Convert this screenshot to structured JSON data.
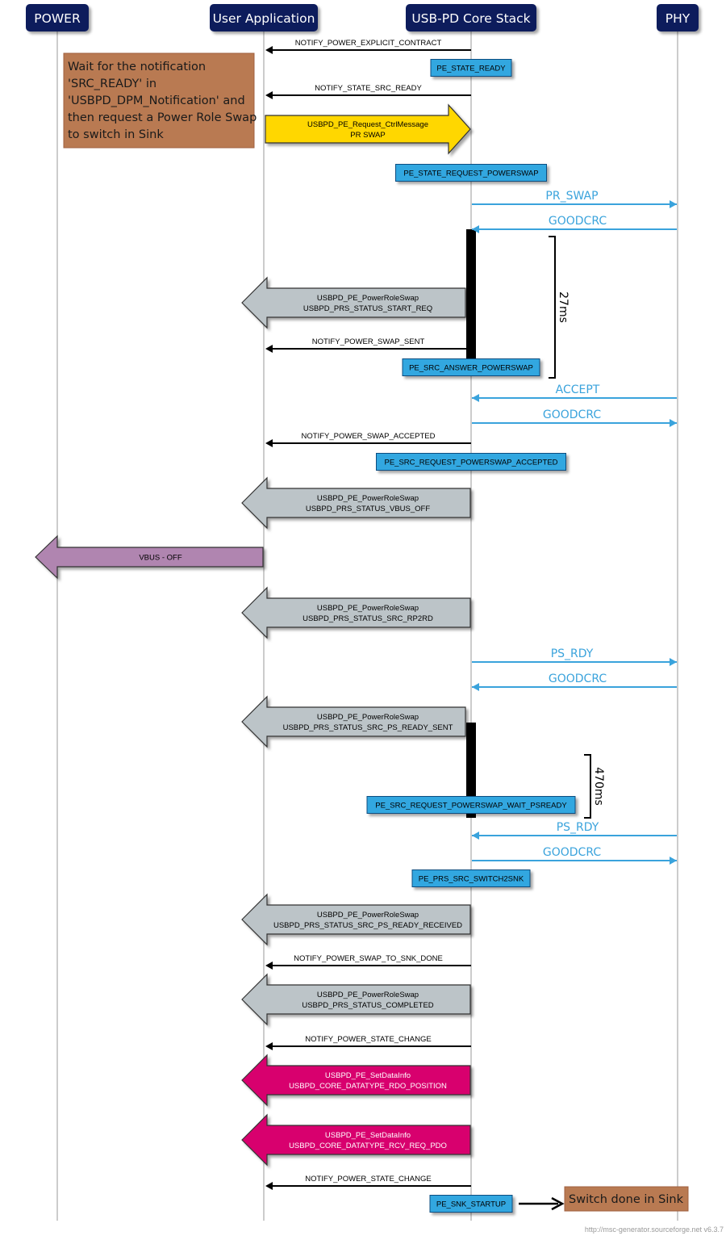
{
  "entities": [
    {
      "id": "power",
      "label": "POWER"
    },
    {
      "id": "app",
      "label": "User Application"
    },
    {
      "id": "core",
      "label": "USB-PD Core Stack"
    },
    {
      "id": "phy",
      "label": "PHY"
    }
  ],
  "colors": {
    "header_bg": "#0a1a5c",
    "lifeline": "#b0b0b0",
    "state_box": "#30a7e0",
    "phy_message": "#3aa3dc",
    "note_bg": "#b97a52",
    "request_arrow": "#ffd700",
    "status_arrow": "#bcc4c8",
    "vbus_arrow": "#b085b0",
    "datainfo_arrow": "#d8006e"
  },
  "note_top": {
    "lines": [
      "Wait for the notification",
      "'SRC_READY' in",
      "'USBPD_DPM_Notification' and",
      "then request a Power Role Swap",
      "to switch in Sink"
    ]
  },
  "items": [
    {
      "kind": "msg",
      "from": "core",
      "to": "app",
      "label": "NOTIFY_POWER_EXPLICIT_CONTRACT"
    },
    {
      "kind": "state",
      "label": "PE_STATE_READY"
    },
    {
      "kind": "msg",
      "from": "core",
      "to": "app",
      "label": "NOTIFY_STATE_SRC_READY"
    },
    {
      "kind": "block",
      "style": "request",
      "from": "app",
      "to": "core",
      "lines": [
        "USBPD_PE_Request_CtrlMessage",
        "PR SWAP"
      ]
    },
    {
      "kind": "state",
      "label": "PE_STATE_REQUEST_POWERSWAP"
    },
    {
      "kind": "phy",
      "from": "core",
      "to": "phy",
      "label": "PR_SWAP"
    },
    {
      "kind": "phy",
      "from": "phy",
      "to": "core",
      "label": "GOODCRC"
    },
    {
      "kind": "block",
      "style": "status",
      "from": "core",
      "to": "app",
      "lines": [
        "USBPD_PE_PowerRoleSwap",
        "USBPD_PRS_STATUS_START_REQ"
      ]
    },
    {
      "kind": "msg",
      "from": "core",
      "to": "app",
      "label": "NOTIFY_POWER_SWAP_SENT"
    },
    {
      "kind": "state",
      "label": "PE_SRC_ANSWER_POWERSWAP"
    },
    {
      "kind": "phy",
      "from": "phy",
      "to": "core",
      "label": "ACCEPT"
    },
    {
      "kind": "phy",
      "from": "core",
      "to": "phy",
      "label": "GOODCRC"
    },
    {
      "kind": "msg",
      "from": "core",
      "to": "app",
      "label": "NOTIFY_POWER_SWAP_ACCEPTED"
    },
    {
      "kind": "state",
      "label": "PE_SRC_REQUEST_POWERSWAP_ACCEPTED"
    },
    {
      "kind": "block",
      "style": "status",
      "from": "core",
      "to": "app",
      "lines": [
        "USBPD_PE_PowerRoleSwap",
        "USBPD_PRS_STATUS_VBUS_OFF"
      ]
    },
    {
      "kind": "block",
      "style": "vbus",
      "from": "app",
      "to": "power",
      "lines": [
        "VBUS - OFF"
      ]
    },
    {
      "kind": "block",
      "style": "status",
      "from": "core",
      "to": "app",
      "lines": [
        "USBPD_PE_PowerRoleSwap",
        "USBPD_PRS_STATUS_SRC_RP2RD"
      ]
    },
    {
      "kind": "phy",
      "from": "core",
      "to": "phy",
      "label": "PS_RDY"
    },
    {
      "kind": "phy",
      "from": "phy",
      "to": "core",
      "label": "GOODCRC"
    },
    {
      "kind": "block",
      "style": "status",
      "from": "core",
      "to": "app",
      "lines": [
        "USBPD_PE_PowerRoleSwap",
        "USBPD_PRS_STATUS_SRC_PS_READY_SENT"
      ]
    },
    {
      "kind": "state",
      "label": "PE_SRC_REQUEST_POWERSWAP_WAIT_PSREADY"
    },
    {
      "kind": "phy",
      "from": "phy",
      "to": "core",
      "label": "PS_RDY"
    },
    {
      "kind": "phy",
      "from": "core",
      "to": "phy",
      "label": "GOODCRC"
    },
    {
      "kind": "state",
      "label": "PE_PRS_SRC_SWITCH2SNK"
    },
    {
      "kind": "block",
      "style": "status",
      "from": "core",
      "to": "app",
      "lines": [
        "USBPD_PE_PowerRoleSwap",
        "USBPD_PRS_STATUS_SRC_PS_READY_RECEIVED"
      ]
    },
    {
      "kind": "msg",
      "from": "core",
      "to": "app",
      "label": "NOTIFY_POWER_SWAP_TO_SNK_DONE"
    },
    {
      "kind": "block",
      "style": "status",
      "from": "core",
      "to": "app",
      "lines": [
        "USBPD_PE_PowerRoleSwap",
        "USBPD_PRS_STATUS_COMPLETED"
      ]
    },
    {
      "kind": "msg",
      "from": "core",
      "to": "app",
      "label": "NOTIFY_POWER_STATE_CHANGE"
    },
    {
      "kind": "block",
      "style": "datainfo",
      "from": "core",
      "to": "app",
      "lines": [
        "USBPD_PE_SetDataInfo",
        "USBPD_CORE_DATATYPE_RDO_POSITION"
      ]
    },
    {
      "kind": "block",
      "style": "datainfo",
      "from": "core",
      "to": "app",
      "lines": [
        "USBPD_PE_SetDataInfo",
        "USBPD_CORE_DATATYPE_RCV_REQ_PDO"
      ]
    },
    {
      "kind": "msg",
      "from": "core",
      "to": "app",
      "label": "NOTIFY_POWER_STATE_CHANGE"
    },
    {
      "kind": "state",
      "label": "PE_SNK_STARTUP"
    }
  ],
  "timers": [
    {
      "label": "27ms"
    },
    {
      "label": "470ms"
    }
  ],
  "note_bottom": {
    "label": "Switch done in Sink"
  },
  "footer": "http://msc-generator.sourceforge.net v6.3.7"
}
